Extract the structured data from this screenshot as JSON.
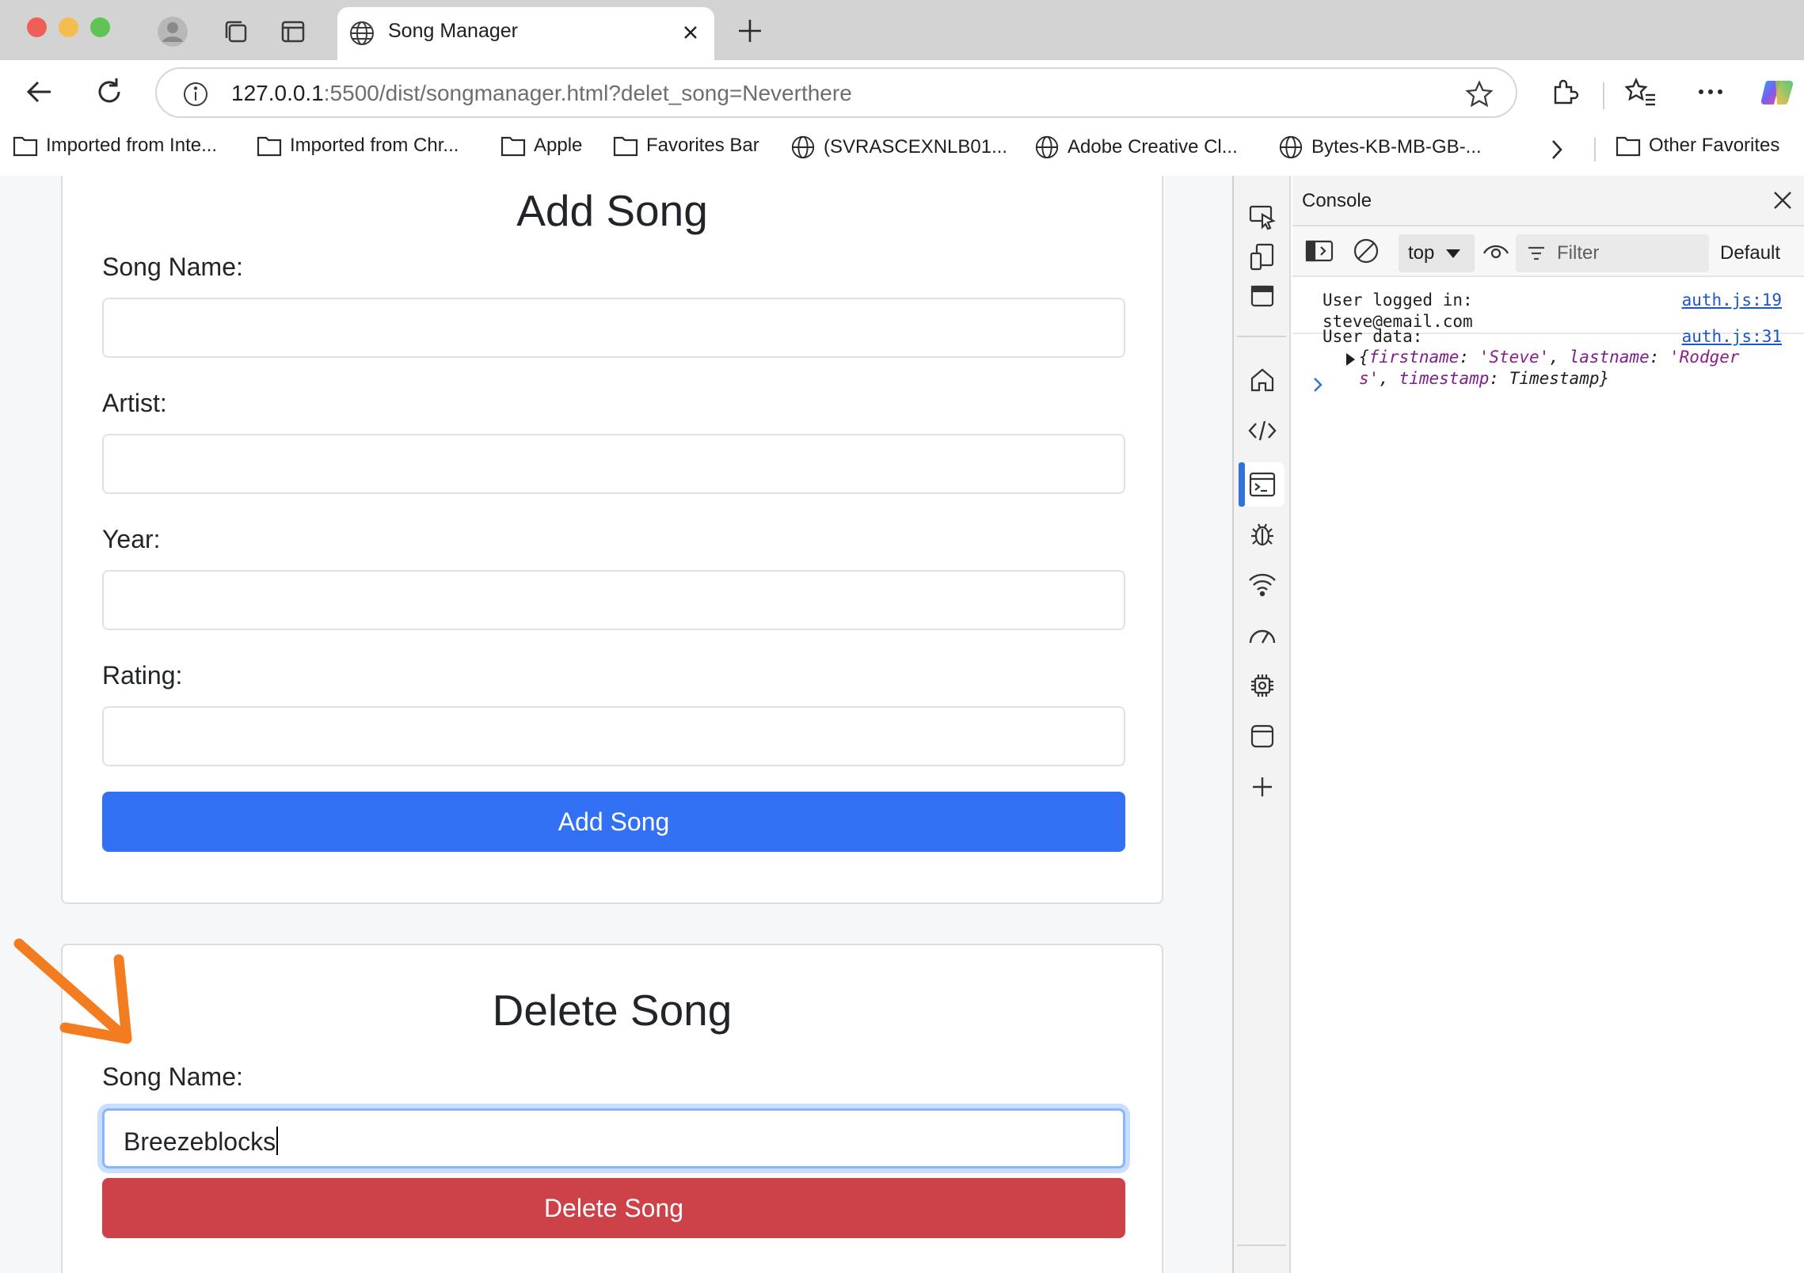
{
  "browser": {
    "tab_title": "Song Manager",
    "url_host": "127.0.0.1",
    "url_rest": ":5500/dist/songmanager.html?delet_song=Neverthere"
  },
  "bookmarks": [
    "Imported from Inte...",
    "Imported from Chr...",
    "Apple",
    "Favorites Bar",
    "(SVRASCEXNLB01...",
    "Adobe Creative Cl...",
    "Bytes-KB-MB-GB-...",
    "Other Favorites"
  ],
  "add_form": {
    "title": "Add Song",
    "song_name_label": "Song Name:",
    "artist_label": "Artist:",
    "year_label": "Year:",
    "rating_label": "Rating:",
    "submit_label": "Add Song",
    "submit_color": "#3371f4"
  },
  "delete_form": {
    "title": "Delete Song",
    "song_name_label": "Song Name:",
    "song_name_value": "Breezeblocks",
    "submit_label": "Delete Song",
    "submit_color": "#cd4249"
  },
  "devtools": {
    "panel_title": "Console",
    "context": "top",
    "filter_placeholder": "Filter",
    "levels": "Default",
    "messages": [
      {
        "text_line1": "User logged in:",
        "text_line2": "steve@email.com",
        "source": "auth.js:19"
      },
      {
        "text": "User data:",
        "source": "auth.js:31",
        "object_firstname_key": "firstname",
        "object_firstname_val": "'Steve'",
        "object_lastname_key": "lastname",
        "object_lastname_val_a": "'Rodger",
        "object_lastname_val_b": "s'",
        "object_timestamp_key": "timestamp",
        "object_timestamp_val": "Timestamp"
      }
    ]
  },
  "annotation": {
    "arrow_color": "#f47c20"
  }
}
